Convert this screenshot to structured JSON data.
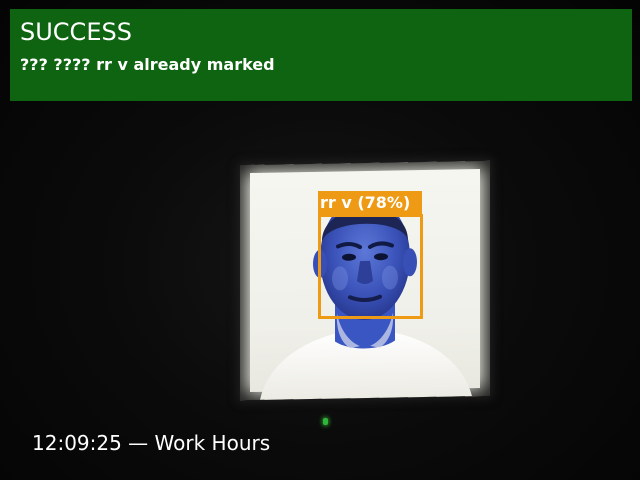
{
  "banner": {
    "title": "SUCCESS",
    "message": "??? ???? rr v already marked",
    "color": "#0e6410"
  },
  "detection": {
    "label": "rr v (78%)",
    "color": "#ef9a14"
  },
  "footer": {
    "timestamp": "12:09:25 — Work Hours"
  },
  "indicator": {
    "color": "#2fb53a"
  }
}
